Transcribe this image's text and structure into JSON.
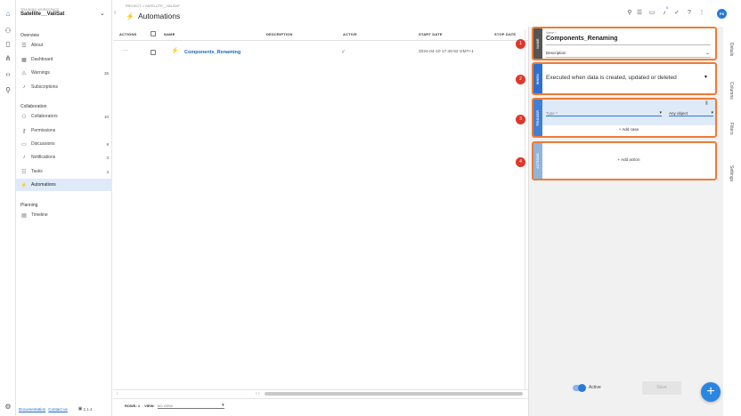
{
  "colors": {
    "accent": "#2a78d8",
    "highlight": "#ee7b35",
    "badge": "#e0362a",
    "name_band": "#555555",
    "when_band": "#2f6fd1",
    "trigger_band": "#3f7fd6",
    "actions_band": "#8fb5dc"
  },
  "workspace": {
    "label": "TRAINING WORKSPACE",
    "name": "Satellite__ValiSat"
  },
  "sidebar": {
    "overview_title": "Overview",
    "overview_items": [
      {
        "label": "About",
        "count": ""
      },
      {
        "label": "Dashboard",
        "count": ""
      },
      {
        "label": "Warnings",
        "count": "36"
      },
      {
        "label": "Subscriptions",
        "count": ""
      }
    ],
    "collab_title": "Collaboration",
    "collab_items": [
      {
        "label": "Collaborators",
        "count": "10"
      },
      {
        "label": "Permissions",
        "count": ""
      },
      {
        "label": "Discussions",
        "count": "9"
      },
      {
        "label": "Notifications",
        "count": "3"
      },
      {
        "label": "Tasks",
        "count": "4"
      },
      {
        "label": "Automations",
        "count": ""
      }
    ],
    "planning_title": "Planning",
    "planning_items": [
      {
        "label": "Timeline",
        "count": ""
      }
    ]
  },
  "header": {
    "breadcrumb": "PROJECT > SATELLITE__VALISAT",
    "title": "Automations",
    "notification_count": "5",
    "avatar_initials": "PS"
  },
  "table": {
    "columns": {
      "actions": "ACTIONS",
      "name": "NAME",
      "description": "DESCRIPTION",
      "active": "ACTIVE",
      "start_date": "START DATE",
      "stop_date": "STOP DATE"
    },
    "rows": [
      {
        "actions": "···",
        "name": "Components_Renaming",
        "description": "",
        "active": "✓",
        "start_date": "2024-04-10 17:46:52 GMT+1",
        "stop_date": ""
      }
    ]
  },
  "footer": {
    "rows_label": "ROWS: 1",
    "view_label": "VIEW:",
    "view_value": "NO VIEW",
    "documentation": "Documentation",
    "contact": "Contact us",
    "version": "2.1.4"
  },
  "panel": {
    "name_section": {
      "band": "NAME",
      "badge": "1",
      "name_label": "Name *",
      "name_value": "Components_Renaming",
      "description_label": "Description"
    },
    "when_section": {
      "band": "WHEN",
      "badge": "2",
      "value": "Executed when data is created, updated or deleted"
    },
    "trigger_section": {
      "band": "TRIGGER",
      "badge": "3",
      "type_placeholder": "Type *",
      "object_value": "Any object",
      "add_case": "+ Add case"
    },
    "actions_section": {
      "band": "ACTIONS",
      "badge": "4",
      "add_action": "+ Add action"
    },
    "active_label": "Active",
    "save_label": "Save"
  },
  "side_tabs": [
    "Details",
    "Columns",
    "Filters",
    "Settings"
  ]
}
